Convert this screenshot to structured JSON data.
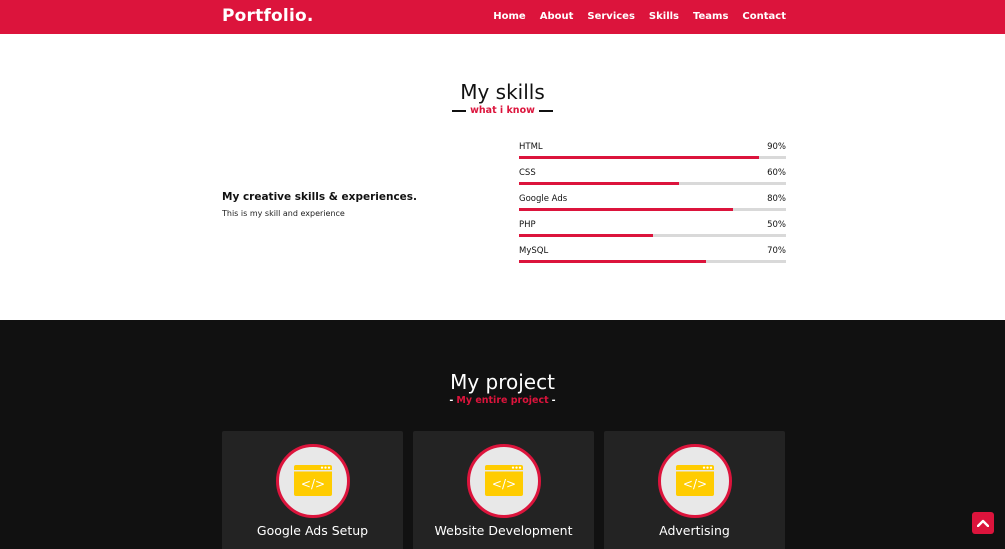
{
  "navbar": {
    "logo": "Portfolio",
    "logo_dot": ".",
    "menu": [
      "Home",
      "About",
      "Services",
      "Skills",
      "Teams",
      "Contact"
    ]
  },
  "skills": {
    "title": "My skills",
    "subtitle": "what i know",
    "heading": "My creative skills & experiences.",
    "description": "This is my skill and experience",
    "items": [
      {
        "name": "HTML",
        "percent_label": "90%",
        "percent": 90
      },
      {
        "name": "CSS",
        "percent_label": "60%",
        "percent": 60
      },
      {
        "name": "Google Ads",
        "percent_label": "80%",
        "percent": 80
      },
      {
        "name": "PHP",
        "percent_label": "50%",
        "percent": 50
      },
      {
        "name": "MySQL",
        "percent_label": "70%",
        "percent": 70
      }
    ]
  },
  "projects": {
    "title": "My project",
    "subtitle": "My entire project",
    "dash": "-",
    "cards": [
      {
        "title": "Google Ads Setup",
        "icon": "code-window-icon"
      },
      {
        "title": "Website Development",
        "icon": "code-window-icon"
      },
      {
        "title": "Advertising",
        "icon": "code-window-icon"
      }
    ]
  },
  "colors": {
    "accent": "#dc143c",
    "dark_bg": "#111111",
    "card_bg": "#232323",
    "icon_yellow": "#ffcc00"
  },
  "scroll_top": {
    "icon": "chevron-up-icon"
  }
}
